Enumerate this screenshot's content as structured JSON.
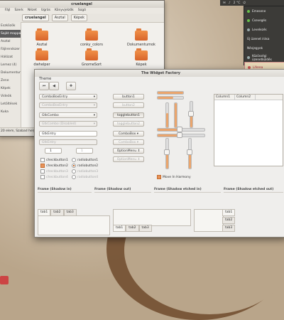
{
  "file_manager": {
    "title": "cruelangel",
    "menu": [
      "Fájl",
      "Szerk",
      "Nézet",
      "Ugrás",
      "Könyvjelzők",
      "Súgó"
    ],
    "path": [
      "cruelangel",
      "Asztal",
      "Képek"
    ],
    "sidebar": [
      "Eszközök",
      "Saját mappa",
      "Asztal",
      "Fájlrendszer",
      "Hálózat",
      "Lemez (4)",
      "Dokumentumok",
      "Zene",
      "Képek",
      "Videók",
      "Letöltések",
      "Kuka"
    ],
    "items": [
      {
        "label": "Asztal"
      },
      {
        "label": "conky_colors"
      },
      {
        "label": "Dokumentumok"
      },
      {
        "label": "dwhelper"
      },
      {
        "label": "GnomeSort"
      },
      {
        "label": "Képek"
      }
    ],
    "status": "20 elem, Szabad hely: 6,5 GB"
  },
  "panel": {
    "clock": "2 °C",
    "indicators": [
      "✉",
      "♪",
      "⏻"
    ]
  },
  "tray_menu": {
    "items": [
      {
        "label": "Emesene",
        "style": "green"
      },
      {
        "label": "Csevegés",
        "style": "green"
      },
      {
        "label": "Levelezés",
        "style": ""
      },
      {
        "label": "Új üzenet írása",
        "style": ""
      },
      {
        "label": "Névjegyek",
        "style": ""
      },
      {
        "label": "Közösségi üzenetküldés",
        "style": ""
      },
      {
        "label": "Liferea",
        "style": "sel"
      }
    ]
  },
  "widget_factory": {
    "title": "The Widget Factory",
    "theme_label": "Theme",
    "combos": [
      "ComboBoxEntry",
      "ComboBoxEntry",
      "GtkCombo",
      "GtkCombo (Disabled)",
      "GtkEntry",
      "GtkEntry"
    ],
    "buttons": [
      "button1",
      "button2",
      "togglebutton1",
      "togglebutton2"
    ],
    "comboboxes": [
      "ComboBox",
      "ComboBox"
    ],
    "optionmenus": [
      "OptionMenu",
      "OptionMenu"
    ],
    "spin_values": [
      "1",
      "1"
    ],
    "checks": [
      {
        "label": "checkbutton1",
        "on": false
      },
      {
        "label": "checkbutton2",
        "on": true
      },
      {
        "label": "checkbutton3",
        "on": false
      },
      {
        "label": "checkbutton4",
        "on": false
      }
    ],
    "radios": [
      {
        "label": "radiobutton1",
        "on": false
      },
      {
        "label": "radiobutton2",
        "on": true
      },
      {
        "label": "radiobutton3",
        "on": false
      },
      {
        "label": "radiobutton4",
        "on": false
      }
    ],
    "move_harmony": "Move In Harmony",
    "tree_columns": [
      "Column1",
      "Column2"
    ],
    "frames": [
      "Frame (Shadow in)",
      "Frame (Shadow out)",
      "Frame (Shadow etched in)",
      "Frame (Shadow etched out)"
    ],
    "tabs": [
      "tab1",
      "tab2",
      "tab3"
    ]
  }
}
